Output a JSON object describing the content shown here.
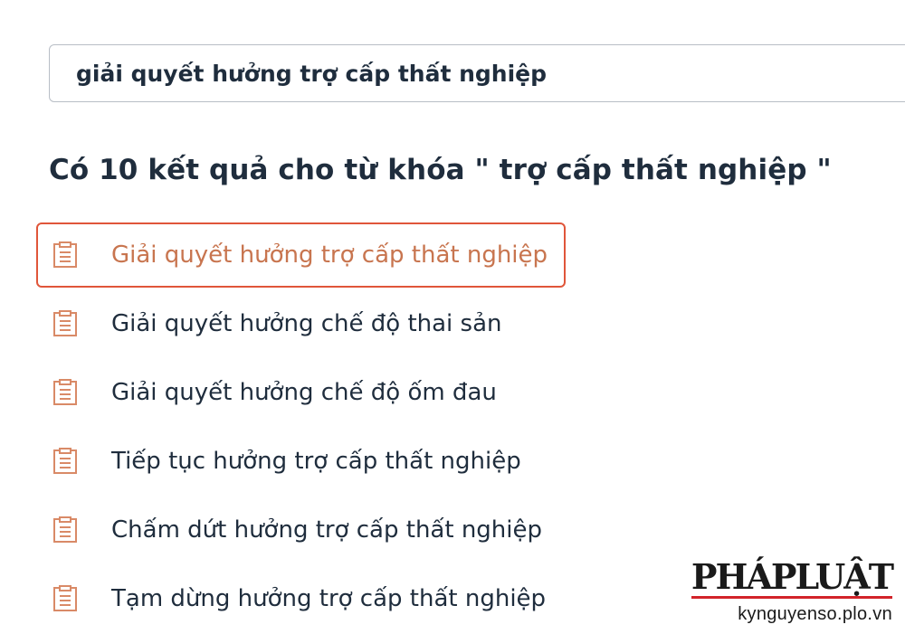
{
  "search": {
    "value": "giải quyết hưởng trợ cấp thất nghiệp",
    "placeholder": ""
  },
  "results": {
    "heading": "Có 10 kết quả cho từ khóa \" trợ cấp thất nghiệp \"",
    "items": [
      {
        "label": "Giải quyết hưởng trợ cấp thất nghiệp",
        "icon": "document-icon",
        "selected": true
      },
      {
        "label": "Giải quyết hưởng chế độ thai sản",
        "icon": "document-icon",
        "selected": false
      },
      {
        "label": "Giải quyết hưởng chế độ ốm đau",
        "icon": "document-icon",
        "selected": false
      },
      {
        "label": "Tiếp tục hưởng trợ cấp thất nghiệp",
        "icon": "document-icon",
        "selected": false
      },
      {
        "label": "Chấm dứt hưởng trợ cấp thất nghiệp",
        "icon": "document-icon",
        "selected": false
      },
      {
        "label": "Tạm dừng hưởng trợ cấp thất nghiệp",
        "icon": "document-icon",
        "selected": false
      }
    ]
  },
  "watermark": {
    "brand": "PHÁPLUẬT",
    "site": "kynguyenso.plo.vn"
  },
  "colors": {
    "accent": "#e0563a",
    "selected_text": "#c8754f",
    "icon": "#d98a67",
    "text": "#1f2d3d",
    "brand_red": "#d2232a"
  }
}
